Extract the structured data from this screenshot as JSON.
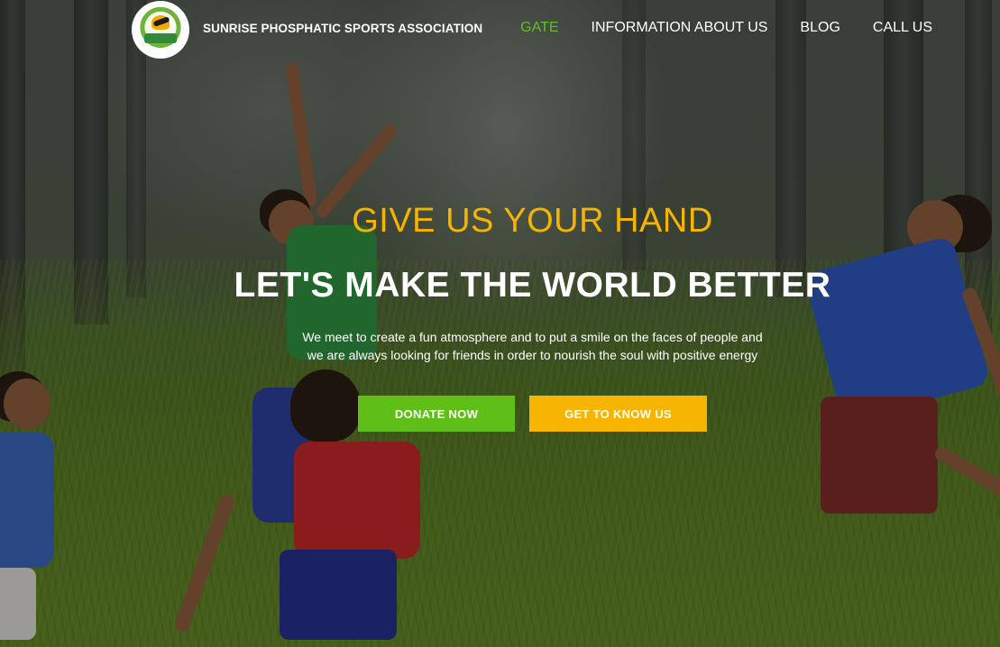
{
  "site": {
    "title": "SUNRISE PHOSPHATIC SPORTS ASSOCIATION",
    "logo_icon": "association-logo"
  },
  "nav": {
    "items": [
      {
        "label": "GATE",
        "active": true
      },
      {
        "label": "INFORMATION ABOUT US",
        "active": false
      },
      {
        "label": "BLOG",
        "active": false
      },
      {
        "label": "CALL US",
        "active": false
      }
    ]
  },
  "hero": {
    "kicker": "GIVE US YOUR HAND",
    "headline": "LET'S MAKE THE WORLD BETTER",
    "description_line1": "We meet to create a fun atmosphere and to put a smile on the faces of people and",
    "description_line2": "we are always looking for friends in order to nourish the soul with positive energy",
    "donate_label": "DONATE NOW",
    "know_label": "GET TO KNOW US"
  },
  "colors": {
    "accent_green": "#5fbf16",
    "accent_yellow": "#f7b400",
    "kicker_yellow": "#f5b400",
    "nav_active": "#5fbf25"
  }
}
